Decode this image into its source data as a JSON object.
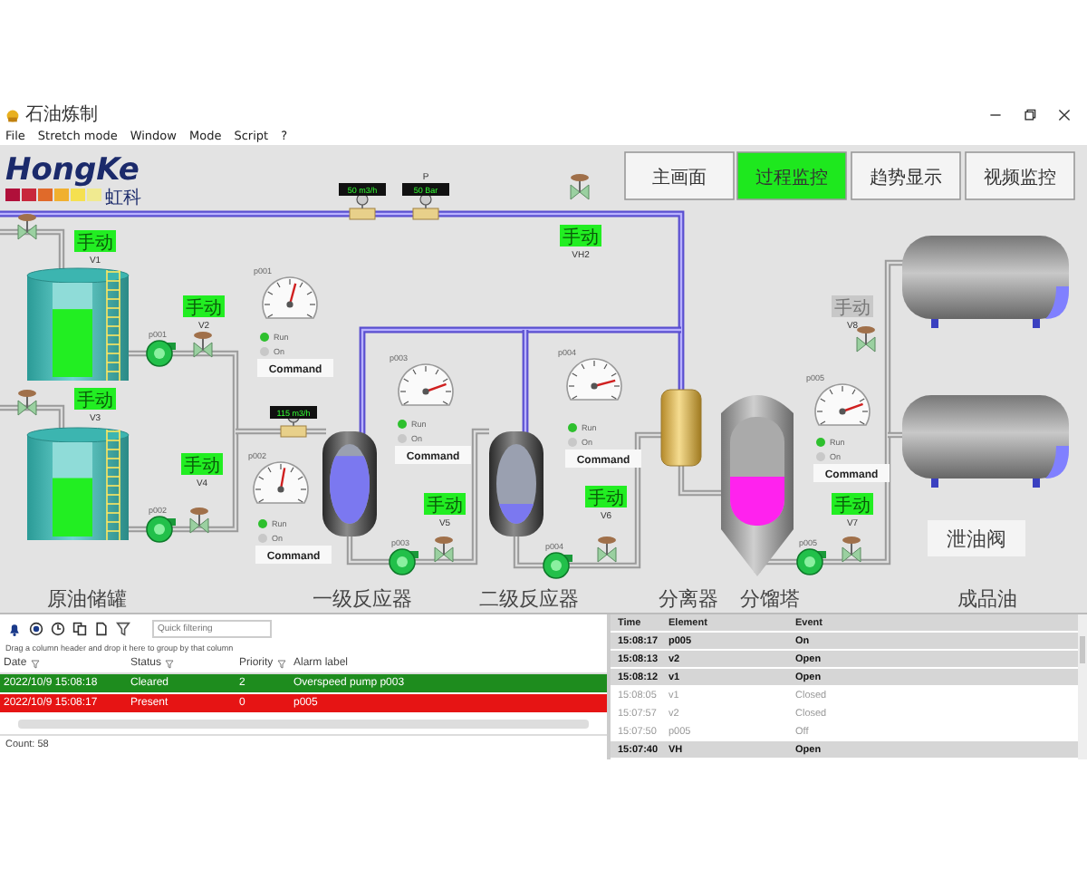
{
  "window": {
    "title": "石油炼制"
  },
  "menu": [
    "File",
    "Stretch mode",
    "Window",
    "Mode",
    "Script",
    "?"
  ],
  "logo": {
    "name": "HongKe",
    "subtitle": "虹科"
  },
  "nav_tabs": [
    {
      "label": "主画面",
      "selected": false
    },
    {
      "label": "过程监控",
      "selected": true
    },
    {
      "label": "趋势显示",
      "selected": false
    },
    {
      "label": "视频监控",
      "selected": false
    }
  ],
  "flow_meters": [
    {
      "reading": "50 m3/h"
    },
    {
      "label": "P",
      "reading": "50 Bar"
    },
    {
      "reading": "115 m3/h"
    }
  ],
  "tanks": [
    {
      "level": 0.72
    },
    {
      "level": 0.62
    }
  ],
  "reactors": [
    {
      "level": 0.85
    },
    {
      "level": 0.25
    }
  ],
  "column": {
    "level": 0.45
  },
  "valves": [
    {
      "name": "V1",
      "mode": "手动",
      "active": true
    },
    {
      "name": "V2",
      "mode": "手动",
      "active": true
    },
    {
      "name": "V3",
      "mode": "手动",
      "active": true
    },
    {
      "name": "V4",
      "mode": "手动",
      "active": true
    },
    {
      "name": "V5",
      "mode": "手动",
      "active": true
    },
    {
      "name": "VH2",
      "mode": "手动",
      "active": true
    },
    {
      "name": "V6",
      "mode": "手动",
      "active": true
    },
    {
      "name": "V8",
      "mode": "手动",
      "active": false
    },
    {
      "name": "V7",
      "mode": "手动",
      "active": true
    }
  ],
  "pumps": [
    {
      "tag": "p001"
    },
    {
      "tag": "p002"
    },
    {
      "tag": "p003"
    },
    {
      "tag": "p004"
    },
    {
      "tag": "p005"
    }
  ],
  "monitors": [
    {
      "tag": "p001",
      "indicators": [
        {
          "label": "Run",
          "on": true
        },
        {
          "label": "On",
          "on": false
        }
      ],
      "command": "Command"
    },
    {
      "tag": "p002",
      "indicators": [
        {
          "label": "Run",
          "on": true
        },
        {
          "label": "On",
          "on": false
        }
      ],
      "command": "Command"
    },
    {
      "tag": "p003",
      "indicators": [
        {
          "label": "Run",
          "on": true
        },
        {
          "label": "On",
          "on": false
        }
      ],
      "command": "Command"
    },
    {
      "tag": "p004",
      "indicators": [
        {
          "label": "Run",
          "on": true
        },
        {
          "label": "On",
          "on": false
        }
      ],
      "command": "Command"
    },
    {
      "tag": "p005",
      "indicators": [
        {
          "label": "Run",
          "on": true
        },
        {
          "label": "On",
          "on": false
        }
      ],
      "command": "Command"
    }
  ],
  "drain_valve_label": "泄油阀",
  "process_labels": [
    "原油储罐",
    "一级反应器",
    "二级反应器",
    "分离器",
    "分馏塔",
    "成品油"
  ],
  "alarms": {
    "filter_placeholder": "Quick filtering",
    "group_hint": "Drag a column header and drop it here to group by that column",
    "columns": [
      "Date",
      "Status",
      "Priority",
      "Alarm label"
    ],
    "rows": [
      {
        "date": "2022/10/9 15:08:18",
        "status": "Cleared",
        "priority": "2",
        "label": "Overspeed pump p003",
        "color": "#1e8c1e"
      },
      {
        "date": "2022/10/9 15:08:17",
        "status": "Present",
        "priority": "0",
        "label": "p005",
        "color": "#e61414"
      }
    ],
    "count": "Count: 58"
  },
  "events": {
    "columns": [
      "Time",
      "Element",
      "Event"
    ],
    "rows": [
      {
        "time": "15:08:17",
        "element": "p005",
        "event": "On",
        "active": true
      },
      {
        "time": "15:08:13",
        "element": "v2",
        "event": "Open",
        "active": true
      },
      {
        "time": "15:08:12",
        "element": "v1",
        "event": "Open",
        "active": true
      },
      {
        "time": "15:08:05",
        "element": "v1",
        "event": "Closed",
        "active": false
      },
      {
        "time": "15:07:57",
        "element": "v2",
        "event": "Closed",
        "active": false
      },
      {
        "time": "15:07:50",
        "element": "p005",
        "event": "Off",
        "active": false
      },
      {
        "time": "15:07:40",
        "element": "VH",
        "event": "Open",
        "active": true
      }
    ]
  }
}
